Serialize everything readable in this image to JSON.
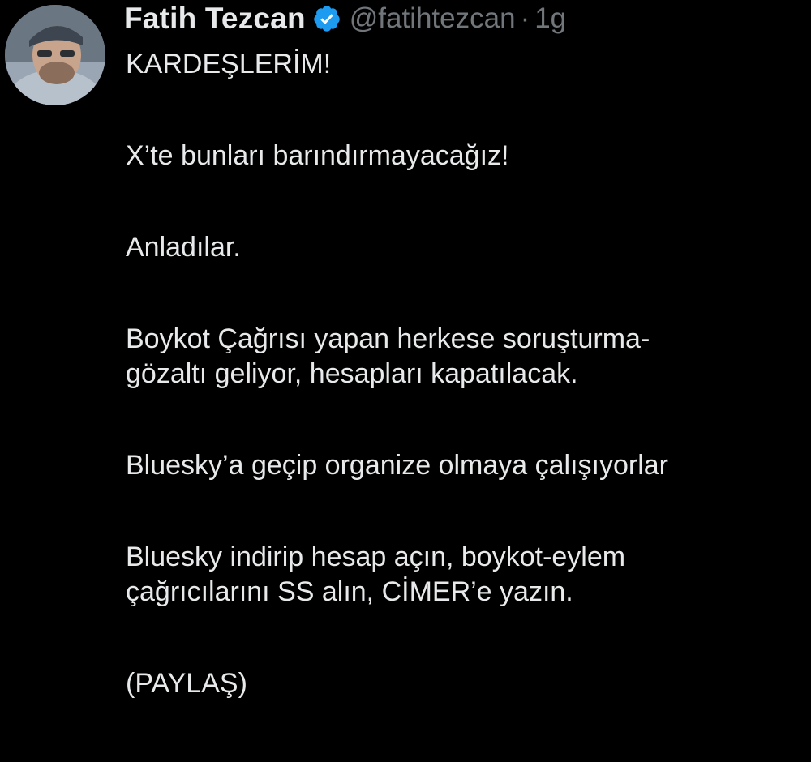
{
  "tweet": {
    "author": {
      "display_name": "Fatih Tezcan",
      "handle": "@fatihtezcan",
      "verified": true,
      "avatar_icon": "avatar-photo-icon"
    },
    "separator": "·",
    "timestamp": "1g",
    "lines": [
      "KARDEŞLERİM!",
      "X’te bunları barındırmayacağız!",
      "Anladılar.",
      "Boykot Çağrısı yapan herkese soruşturma-",
      "gözaltı geliyor, hesapları kapatılacak.",
      "Bluesky’a geçip organize olmaya çalışıyorlar",
      "Bluesky indirip hesap açın, boykot-eylem",
      "çağrıcılarını SS alın, CİMER’e yazın.",
      "(PAYLAŞ)"
    ]
  },
  "colors": {
    "background": "#000000",
    "text_primary": "#e7e9ea",
    "text_secondary": "#71767b",
    "verified_badge": "#1d9bf0"
  }
}
